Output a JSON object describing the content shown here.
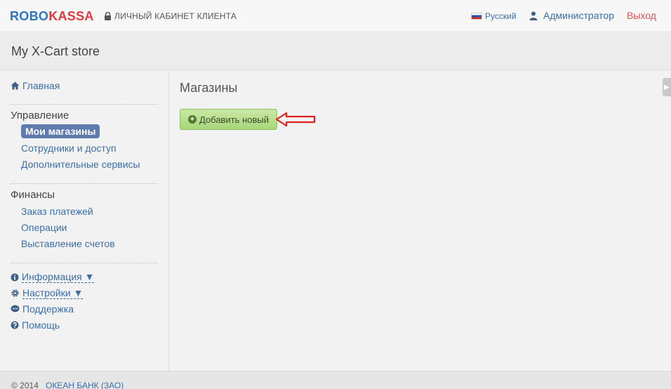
{
  "header": {
    "logo_robo": "ROBO",
    "logo_kassa": "KASSA",
    "cabinet": "ЛИЧНЫЙ КАБИНЕТ КЛИЕНТА",
    "language": "Русский",
    "user": "Администратор",
    "logout": "Выход"
  },
  "store": {
    "title": "My X-Cart store"
  },
  "sidebar": {
    "home": "Главная",
    "management": {
      "title": "Управление",
      "items": [
        "Мои магазины",
        "Сотрудники и доступ",
        "Дополнительные сервисы"
      ]
    },
    "finance": {
      "title": "Финансы",
      "items": [
        "Заказ платежей",
        "Операции",
        "Выставление счетов"
      ]
    },
    "info": "Информация ▼",
    "settings": "Настройки ▼",
    "support": "Поддержка",
    "help": "Помощь"
  },
  "main": {
    "heading": "Магазины",
    "add_button": "Добавить новый"
  },
  "footer": {
    "copyright": "© 2014",
    "bank": "ОКЕАН БАНК (ЗАО)"
  },
  "colors": {
    "link": "#3a6fa8",
    "active": "#5e7bae",
    "logout": "#d9534f",
    "button": "#a8d67b",
    "arrow": "#e02020"
  }
}
